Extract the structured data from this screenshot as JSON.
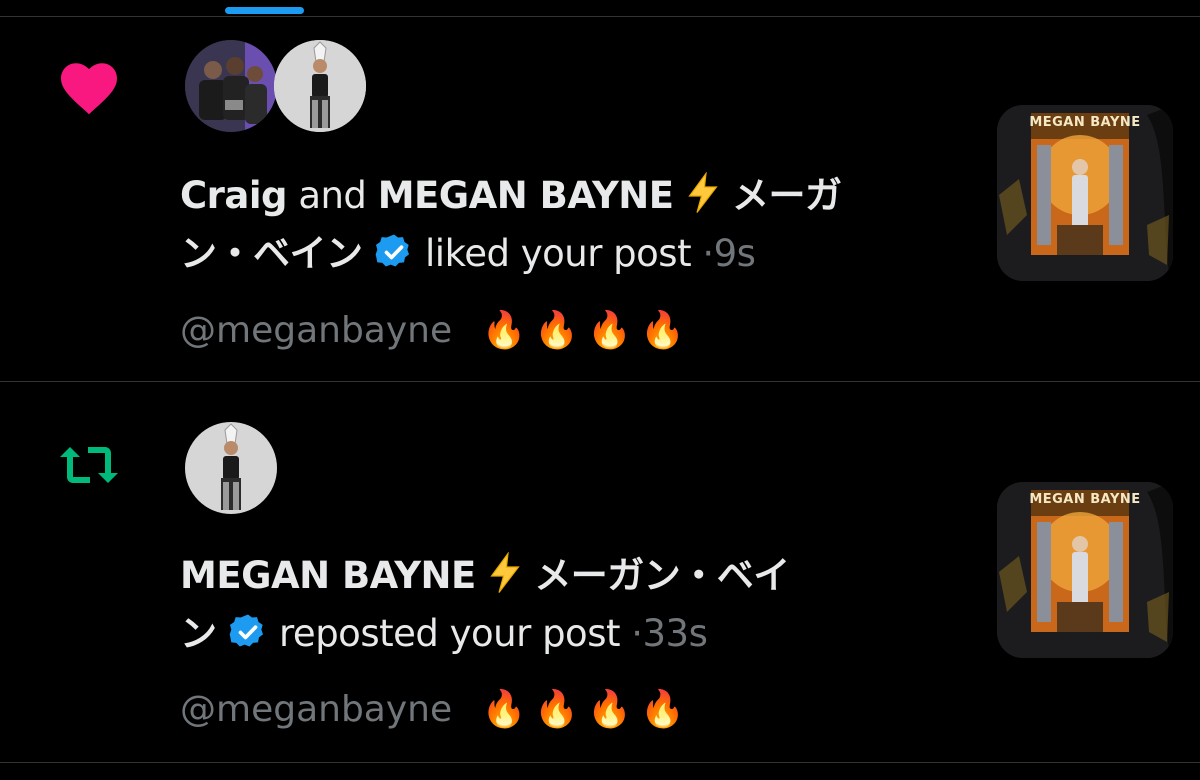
{
  "notifications": [
    {
      "kind": "like",
      "kind_icon": "heart-icon",
      "kind_color": "#f91880",
      "actor_1": "Craig",
      "joiner": "and",
      "actor_2_line1": "MEGAN BAYNE",
      "actor_2_suffix_line1": "メーガ",
      "line2_start": "ン・ベイン",
      "action": "liked your post",
      "separator": "·",
      "time": "9s",
      "quoted_handle": "@meganbayne",
      "quoted_emojis": "🔥🔥🔥🔥",
      "thumbnail_text": "MEGAN BAYNE"
    },
    {
      "kind": "repost",
      "kind_icon": "repost-icon",
      "kind_color": "#00ba7c",
      "actor_line1": "MEGAN BAYNE",
      "actor_suffix_line1": "メーガン・ベイ",
      "line2_start": "ン",
      "action": "reposted your post",
      "separator": "·",
      "time": "33s",
      "quoted_handle": "@meganbayne",
      "quoted_emojis": "🔥🔥🔥🔥",
      "thumbnail_text": "MEGAN BAYNE"
    }
  ],
  "colors": {
    "verified": "#1d9bf0",
    "lightning": "#ffc83d",
    "accent": "#1d9bf0"
  }
}
